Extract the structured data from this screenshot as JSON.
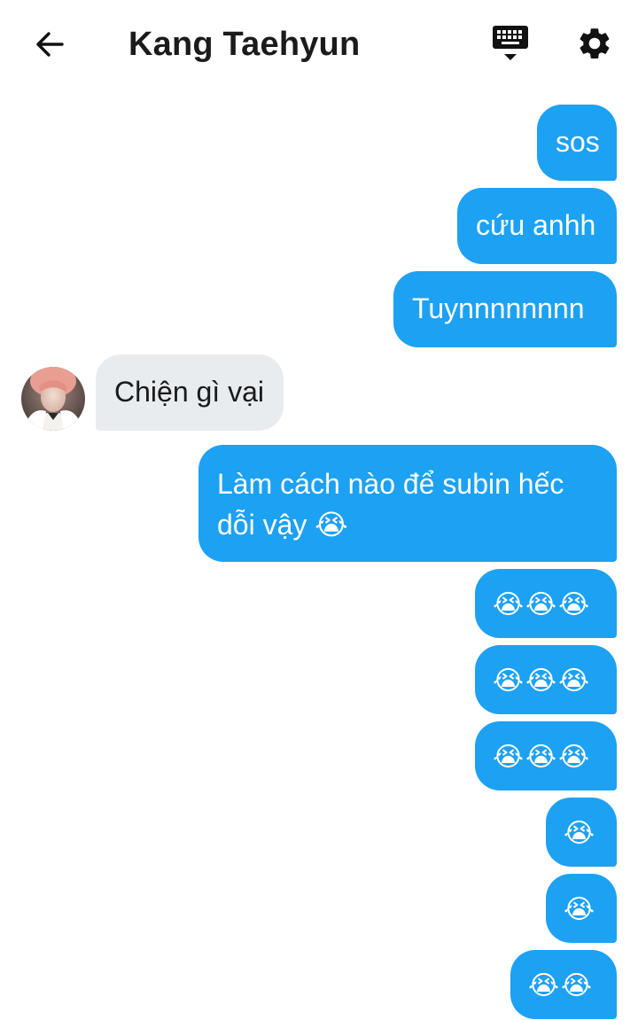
{
  "header": {
    "title": "Kang Taehyun",
    "back_icon": "arrow-left-icon",
    "keyboard_icon": "keyboard-icon",
    "settings_icon": "gear-icon"
  },
  "colors": {
    "sent_bubble": "#1da1f2",
    "received_bubble": "#e8ecef",
    "background": "#ffffff"
  },
  "messages": [
    {
      "from": "me",
      "text": "sos"
    },
    {
      "from": "me",
      "text": "cứu anhh"
    },
    {
      "from": "me",
      "text": "Tuynnnnnnnn"
    },
    {
      "from": "them",
      "text": "Chiện gì vại"
    },
    {
      "from": "me",
      "text": "Làm cách nào để subin hếc dỗi vậy 😭"
    },
    {
      "from": "me",
      "text": "😭😭😭"
    },
    {
      "from": "me",
      "text": "😭😭😭"
    },
    {
      "from": "me",
      "text": "😭😭😭"
    },
    {
      "from": "me",
      "text": "😭"
    },
    {
      "from": "me",
      "text": "😭"
    },
    {
      "from": "me",
      "text": "😭😭"
    }
  ]
}
